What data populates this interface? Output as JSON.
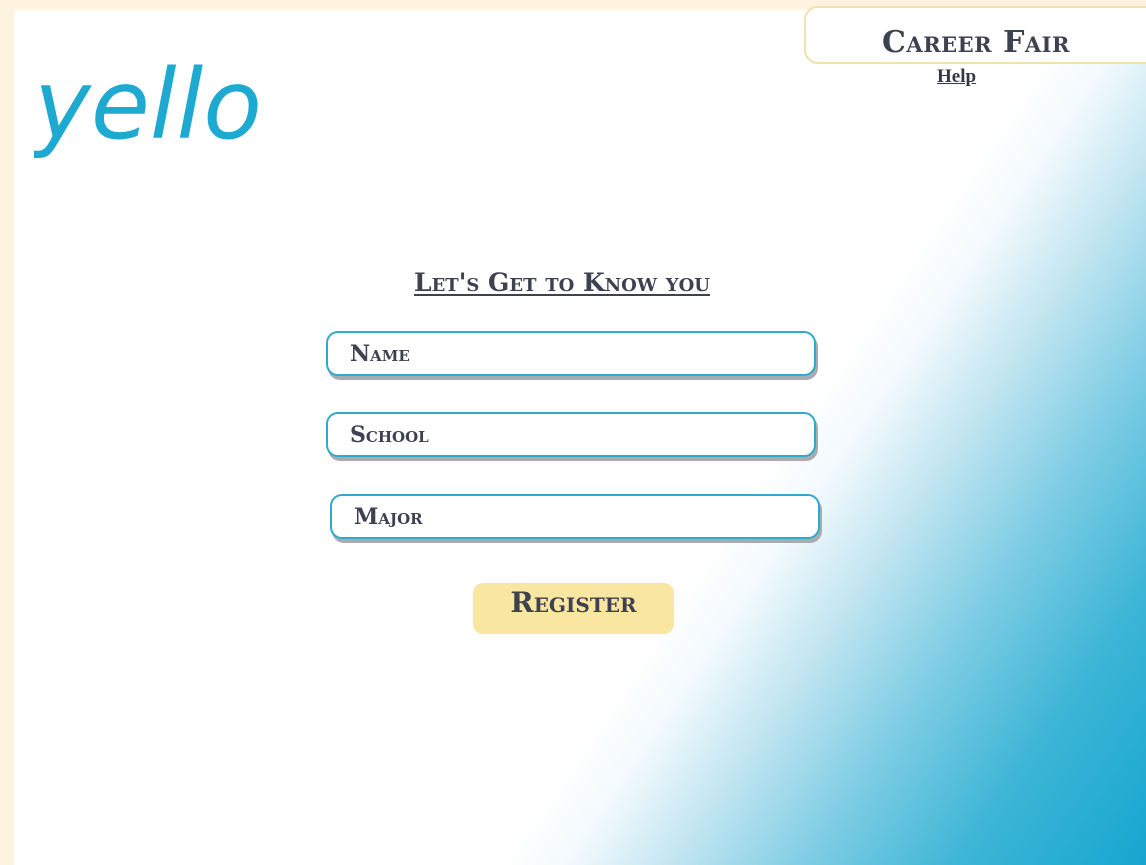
{
  "header": {
    "logo_text": "yello",
    "event_title": "Career Fair",
    "help_link": "Help"
  },
  "form": {
    "heading": "Let's Get to Know you",
    "fields": {
      "name": {
        "placeholder": "Name",
        "value": ""
      },
      "school": {
        "placeholder": "School",
        "value": ""
      },
      "major": {
        "placeholder": "Major",
        "value": ""
      }
    },
    "submit_label": "Register"
  },
  "colors": {
    "brand_blue": "#1ea9d1",
    "field_border": "#2fa9cc",
    "button_fill": "#f9e6a1",
    "accent_cream": "#fdf3df",
    "text_dark": "#3d4150"
  }
}
